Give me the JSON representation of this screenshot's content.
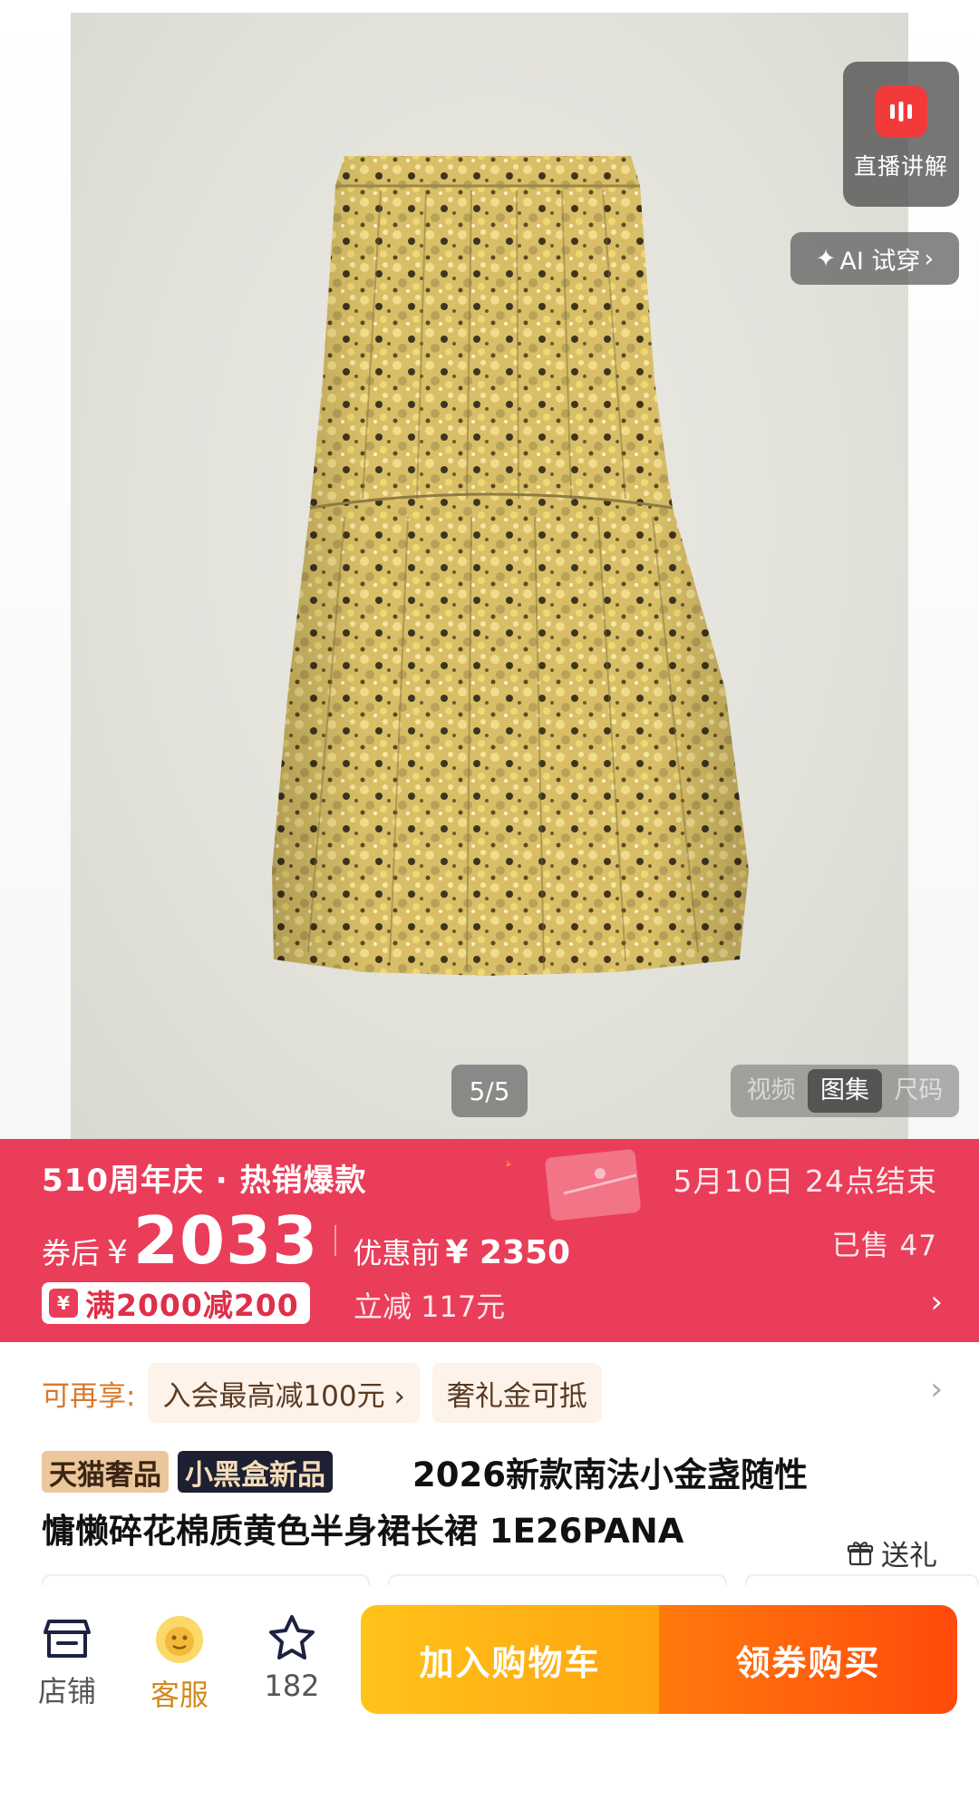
{
  "gallery": {
    "live_label": "直播讲解",
    "ai_label": "AI 试穿",
    "counter": "5/5",
    "tabs": [
      "视频",
      "图集",
      "尺码"
    ],
    "active_tab": "图集"
  },
  "promo": {
    "title": "510周年庆 · 热销爆款",
    "end_time": "5月10日 24点结束",
    "price_prefix": "券后",
    "currency": "¥",
    "price": "2033",
    "orig_label": "优惠前",
    "orig_price": "¥ 2350",
    "sold": "已售 47",
    "coupon_icon": "¥",
    "coupon_text": "满2000减200",
    "instant": "立减 117元",
    "colors": {
      "band": "#ea3d5a",
      "coupon_text": "#e02e4a"
    }
  },
  "benefits": {
    "label": "可再享:",
    "chips": [
      "入会最高减100元 ›",
      "奢礼金可抵"
    ]
  },
  "title": {
    "tag_tmall": "天猫奢品",
    "tag_box": "小黑盒新品",
    "line1": "2026新款南法小金盏随性",
    "line2": "慵懒碎花棉质黄色半身裙长裙 1E26PANA",
    "gift": "送礼"
  },
  "bottom_bar": {
    "store": "店铺",
    "service": "客服",
    "favorites": "182",
    "cart": "加入购物车",
    "buy": "领券购买"
  }
}
